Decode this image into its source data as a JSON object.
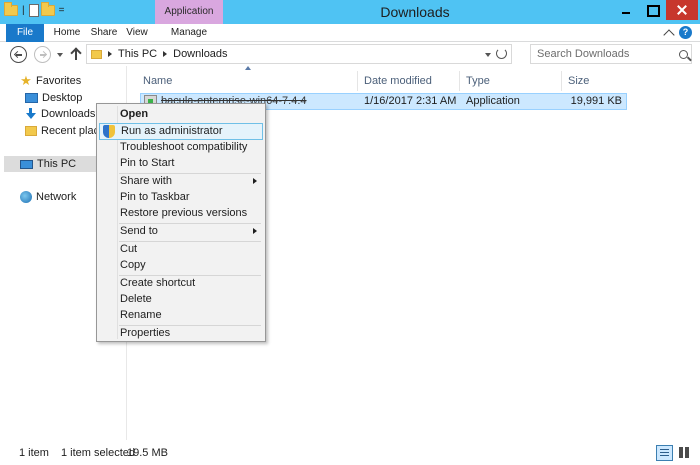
{
  "window": {
    "title": "Downloads",
    "contextual_tab_group": "Application Tools"
  },
  "ribbon": {
    "tabs": [
      {
        "label": "File"
      },
      {
        "label": "Home"
      },
      {
        "label": "Share"
      },
      {
        "label": "View"
      },
      {
        "label": "Manage"
      }
    ]
  },
  "address": {
    "crumbs": [
      "This PC",
      "Downloads"
    ],
    "search_placeholder": "Search Downloads"
  },
  "nav": {
    "favorites": "Favorites",
    "items": [
      {
        "label": "Desktop"
      },
      {
        "label": "Downloads"
      },
      {
        "label": "Recent places"
      }
    ],
    "this_pc": "This PC",
    "network": "Network"
  },
  "columns": {
    "name": "Name",
    "date": "Date modified",
    "type": "Type",
    "size": "Size"
  },
  "files": [
    {
      "name": "bacula-enterprise-win64-7.4.4",
      "date": "1/16/2017 2:31 AM",
      "type": "Application",
      "size": "19,991 KB"
    }
  ],
  "context_menu": {
    "open": "Open",
    "run_as_admin": "Run as administrator",
    "troubleshoot": "Troubleshoot compatibility",
    "pin_start": "Pin to Start",
    "share_with": "Share with",
    "pin_taskbar": "Pin to Taskbar",
    "restore": "Restore previous versions",
    "send_to": "Send to",
    "cut": "Cut",
    "copy": "Copy",
    "create_shortcut": "Create shortcut",
    "delete": "Delete",
    "rename": "Rename",
    "properties": "Properties"
  },
  "status": {
    "count": "1 item",
    "selected": "1 item selected",
    "size": "19.5 MB"
  },
  "colors": {
    "titlebar": "#4fc3f3",
    "contextual_tab": "#d9a7df",
    "file_tab": "#1979ca",
    "close_button": "#c7372d",
    "selection": "#cce8ff"
  }
}
